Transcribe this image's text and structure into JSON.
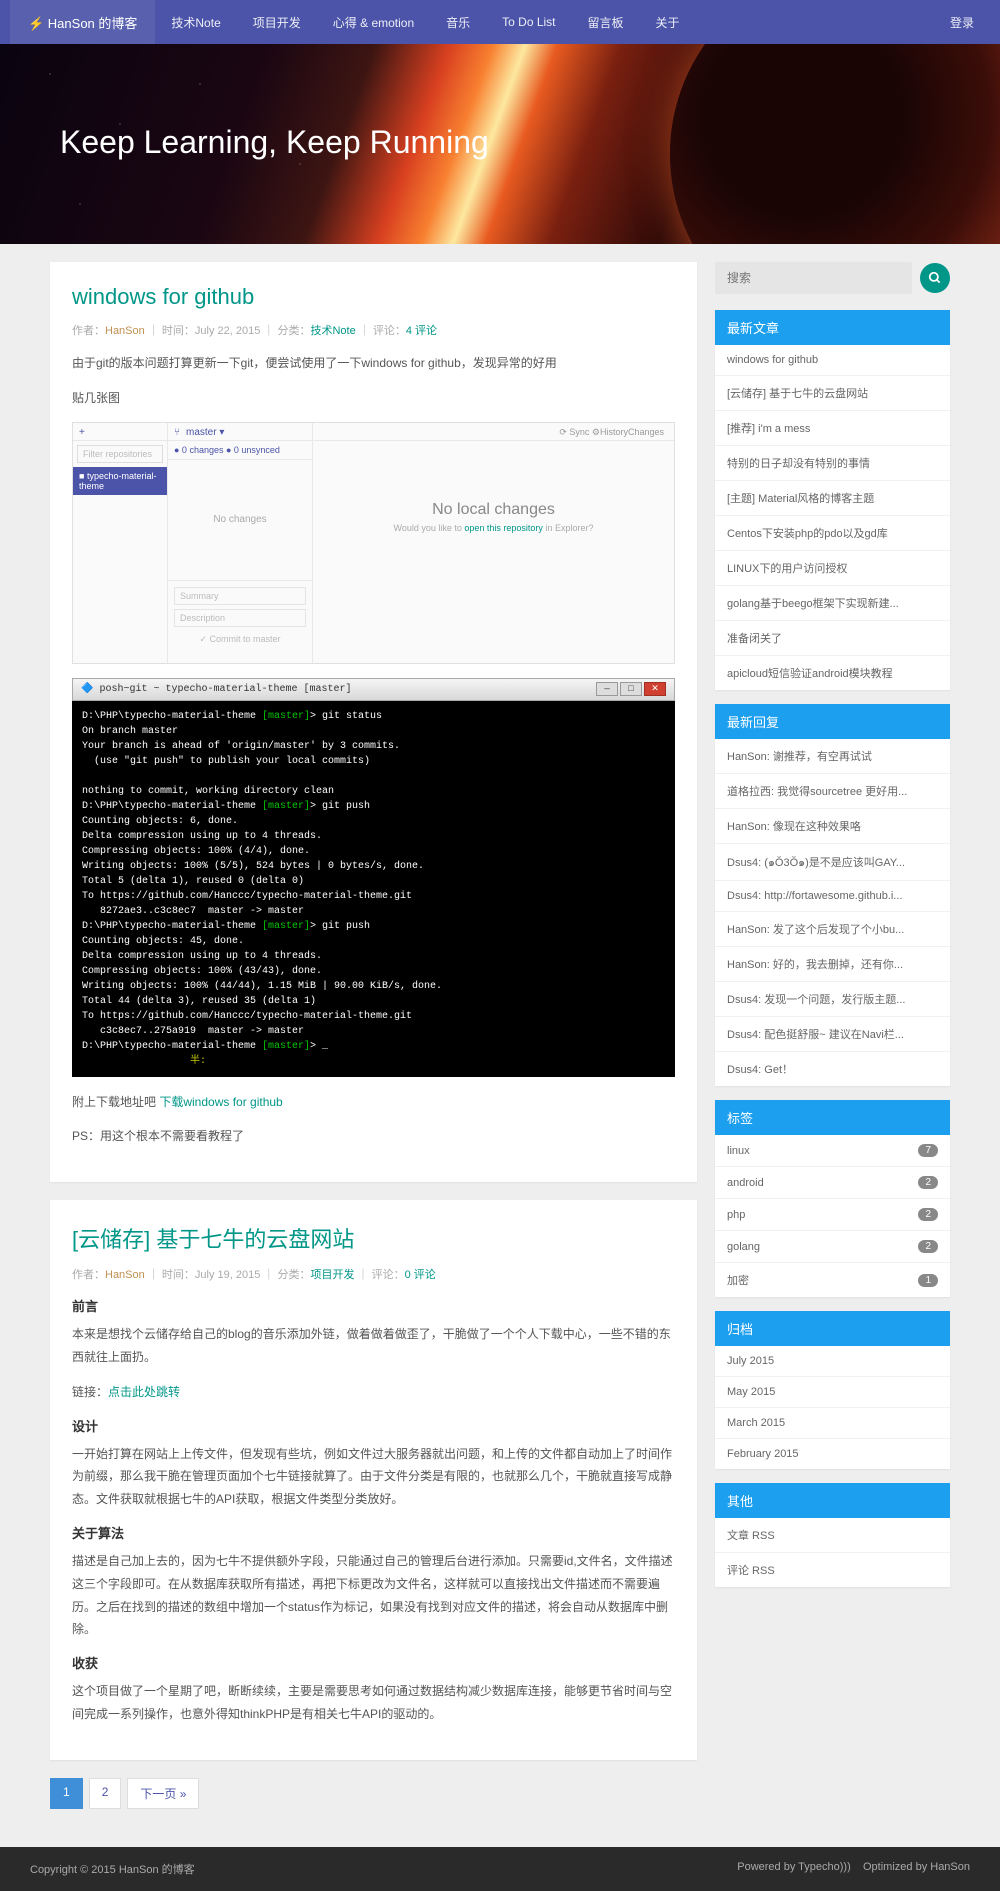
{
  "nav": {
    "brand": "⚡ HanSon 的博客",
    "items": [
      "技术Note",
      "项目开发",
      "心得 & emotion",
      "音乐",
      "To Do List",
      "留言板",
      "关于"
    ],
    "login": "登录"
  },
  "hero": {
    "title": "Keep Learning, Keep Running"
  },
  "posts": [
    {
      "title": "windows for github",
      "author": "HanSon",
      "date": "July 22, 2015",
      "category": "技术Note",
      "comments": "4 评论",
      "p1": "由于git的版本问题打算更新一下git，便尝试使用了一下windows for github，发现异常的好用",
      "p2": "贴几张图",
      "gh": {
        "filter": "Filter repositories",
        "repo": "typecho-material-theme",
        "master": "master ▾",
        "changes_tab": "Changes",
        "history_tab": "History",
        "changes_bar": "● 0 changes   ● 0 unsynced",
        "nochanges": "No changes",
        "summary": "Summary",
        "description": "Description",
        "commit": "✓ Commit to master",
        "nolocal": "No local changes",
        "nolocal_sub_1": "Would you like to ",
        "nolocal_sub_link": "open this repository",
        "nolocal_sub_2": " in Explorer?",
        "sync": "⟳ Sync   ⚙"
      },
      "term_title": "posh~git ~ typecho-material-theme [master]",
      "p3_pre": "附上下载地址吧 ",
      "p3_link": "下载windows for github",
      "p4": "PS：用这个根本不需要看教程了"
    },
    {
      "title": "[云储存] 基于七牛的云盘网站",
      "author": "HanSon",
      "date": "July 19, 2015",
      "category": "项目开发",
      "comments": "0 评论",
      "h1": "前言",
      "p1": "本来是想找个云储存给自己的blog的音乐添加外链，做着做着做歪了，干脆做了一个个人下载中心，一些不错的东西就往上面扔。",
      "p2_pre": "链接：",
      "p2_link": "点击此处跳转",
      "h2": "设计",
      "p3": "一开始打算在网站上上传文件，但发现有些坑，例如文件过大服务器就出问题，和上传的文件都自动加上了时间作为前缀，那么我干脆在管理页面加个七牛链接就算了。由于文件分类是有限的，也就那么几个，干脆就直接写成静态。文件获取就根据七牛的API获取，根据文件类型分类放好。",
      "h3": "关于算法",
      "p4": "描述是自己加上去的，因为七牛不提供额外字段，只能通过自己的管理后台进行添加。只需要id,文件名，文件描述这三个字段即可。在从数据库获取所有描述，再把下标更改为文件名，这样就可以直接找出文件描述而不需要遍历。之后在找到的描述的数组中增加一个status作为标记，如果没有找到对应文件的描述，将会自动从数据库中删除。",
      "h4": "收获",
      "p5": "这个项目做了一个星期了吧，断断续续，主要是需要思考如何通过数据结构减少数据库连接，能够更节省时间与空间完成一系列操作，也意外得知thinkPHP是有相关七牛API的驱动的。"
    }
  ],
  "pagination": {
    "p1": "1",
    "p2": "2",
    "next": "下一页 »"
  },
  "search": {
    "placeholder": "搜索"
  },
  "widgets": {
    "recent_posts": {
      "title": "最新文章",
      "items": [
        "windows for github",
        "[云储存] 基于七牛的云盘网站",
        "[推荐] i'm a mess",
        "特别的日子却没有特别的事情",
        "[主题] Material风格的博客主题",
        "Centos下安装php的pdo以及gd库",
        "LINUX下的用户访问授权",
        "golang基于beego框架下实现新建...",
        "准备闭关了",
        "apicloud短信验证android模块教程"
      ]
    },
    "recent_comments": {
      "title": "最新回复",
      "items": [
        "HanSon: 谢推荐，有空再试试",
        "道格拉西: 我觉得sourcetree 更好用...",
        "HanSon: 像现在这种效果咯",
        "Dsus4: (๑Ŏ3Ŏ๑)是不是应该叫GAY...",
        "Dsus4: http://fortawesome.github.i...",
        "HanSon: 发了这个后发现了个小bu...",
        "HanSon: 好的，我去删掉，还有你...",
        "Dsus4: 发现一个问题，发行版主题...",
        "Dsus4: 配色挺舒服~ 建议在Navi栏...",
        "Dsus4: Get！"
      ]
    },
    "tags": {
      "title": "标签",
      "items": [
        {
          "n": "linux",
          "c": "7"
        },
        {
          "n": "android",
          "c": "2"
        },
        {
          "n": "php",
          "c": "2"
        },
        {
          "n": "golang",
          "c": "2"
        },
        {
          "n": "加密",
          "c": "1"
        }
      ]
    },
    "archive": {
      "title": "归档",
      "items": [
        "July 2015",
        "May 2015",
        "March 2015",
        "February 2015"
      ]
    },
    "other": {
      "title": "其他",
      "items": [
        "文章 RSS",
        "评论 RSS"
      ]
    }
  },
  "footer": {
    "left": "Copyright © 2015 HanSon 的博客",
    "mid": "Powered by Typecho)))",
    "right": "Optimized by HanSon"
  }
}
